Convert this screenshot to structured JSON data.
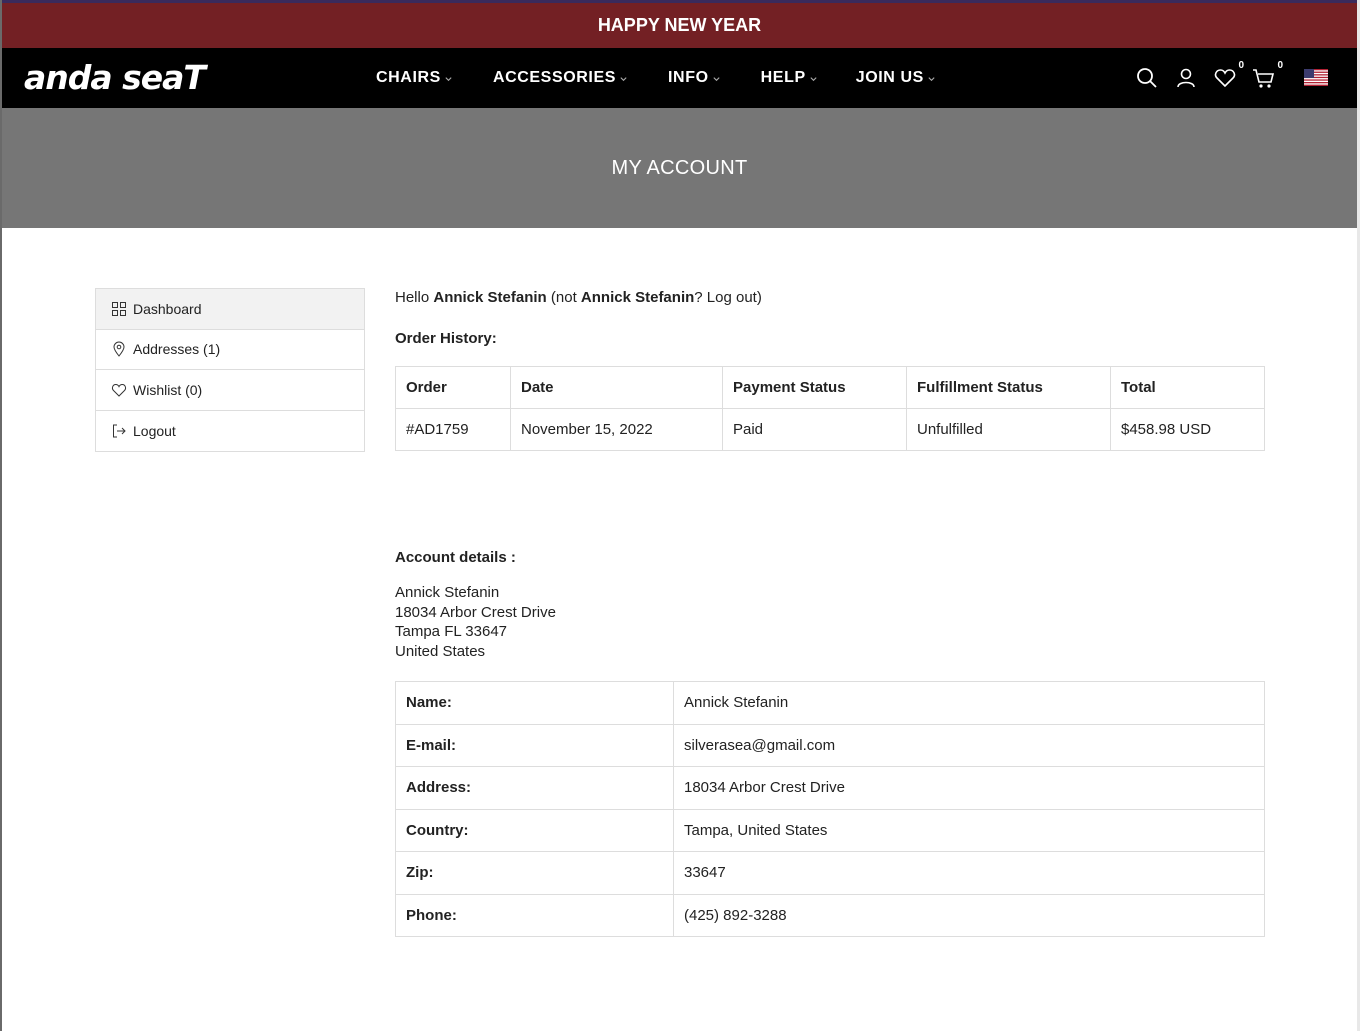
{
  "announcement": "HAPPY NEW YEAR",
  "brand": {
    "logo_text": "anda seaT"
  },
  "nav": [
    {
      "label": "CHAIRS"
    },
    {
      "label": "ACCESSORIES"
    },
    {
      "label": "INFO"
    },
    {
      "label": "HELP"
    },
    {
      "label": "JOIN US"
    }
  ],
  "header_tools": {
    "wishlist_count": "0",
    "cart_count": "0",
    "locale_flag": "us-flag-icon"
  },
  "hero": {
    "title": "MY ACCOUNT"
  },
  "sidebar": {
    "items": [
      {
        "label": "Dashboard",
        "icon": "grid-icon",
        "active": true
      },
      {
        "label": "Addresses (1)",
        "icon": "location-pin-icon"
      },
      {
        "label": "Wishlist (0)",
        "icon": "heart-icon"
      },
      {
        "label": "Logout",
        "icon": "logout-icon"
      }
    ]
  },
  "greeting": {
    "hello": "Hello",
    "name": "Annick Stefanin",
    "not_prefix": "(not",
    "not_name": "Annick Stefanin",
    "suffix": "?",
    "logout": "Log out)"
  },
  "orders": {
    "title": "Order History:",
    "headers": [
      "Order",
      "Date",
      "Payment Status",
      "Fulfillment Status",
      "Total"
    ],
    "rows": [
      [
        "#AD1759",
        "November 15, 2022",
        "Paid",
        "Unfulfilled",
        "$458.98 USD"
      ]
    ]
  },
  "account": {
    "title": "Account details :",
    "address_lines": [
      "Annick Stefanin",
      "18034 Arbor Crest Drive",
      "Tampa FL 33647",
      "United States"
    ],
    "details": [
      {
        "label": "Name:",
        "value": "Annick Stefanin"
      },
      {
        "label": "E-mail:",
        "value": "silverasea@gmail.com"
      },
      {
        "label": "Address:",
        "value": "18034 Arbor Crest Drive"
      },
      {
        "label": "Country:",
        "value": "Tampa, United States"
      },
      {
        "label": "Zip:",
        "value": "33647"
      },
      {
        "label": "Phone:",
        "value": "(425) 892-3288"
      }
    ]
  },
  "colors": {
    "announce_bg": "#732024",
    "header_bg": "#000000",
    "hero_bg": "#767676"
  }
}
